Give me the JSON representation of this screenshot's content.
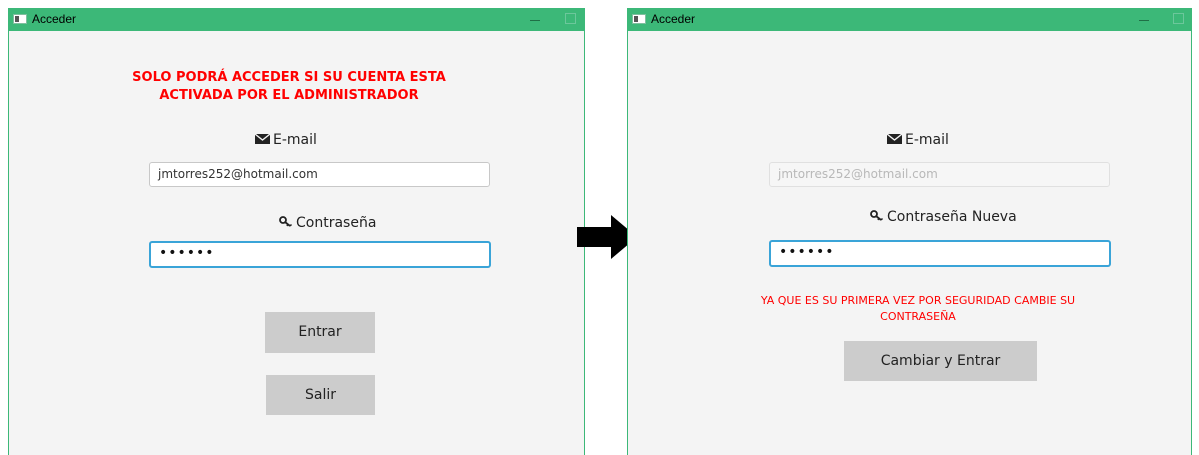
{
  "left_window": {
    "title": "Acceder",
    "warning": "SOLO PODRÁ ACCEDER SI SU CUENTA ESTA ACTIVADA POR EL ADMINISTRADOR",
    "email_label": "E-mail",
    "email_value": "jmtorres252@hotmail.com",
    "password_label": "Contraseña",
    "password_value": "••••••",
    "enter_button": "Entrar",
    "exit_button": "Salir"
  },
  "right_window": {
    "title": "Acceder",
    "email_label": "E-mail",
    "email_value": "jmtorres252@hotmail.com",
    "password_label": "Contraseña Nueva",
    "password_value": "••••••",
    "warning": "YA QUE ES SU PRIMERA VEZ POR SEGURIDAD CAMBIE SU CONTRASEÑA",
    "change_button": "Cambiar y Entrar"
  },
  "colors": {
    "titlebar": "#3cb878",
    "warning": "#ff0000",
    "focus_border": "#3aa4d8",
    "button": "#cccccc"
  },
  "icons": {
    "email": "envelope-icon",
    "password": "key-icon",
    "transition": "right-arrow-icon"
  }
}
